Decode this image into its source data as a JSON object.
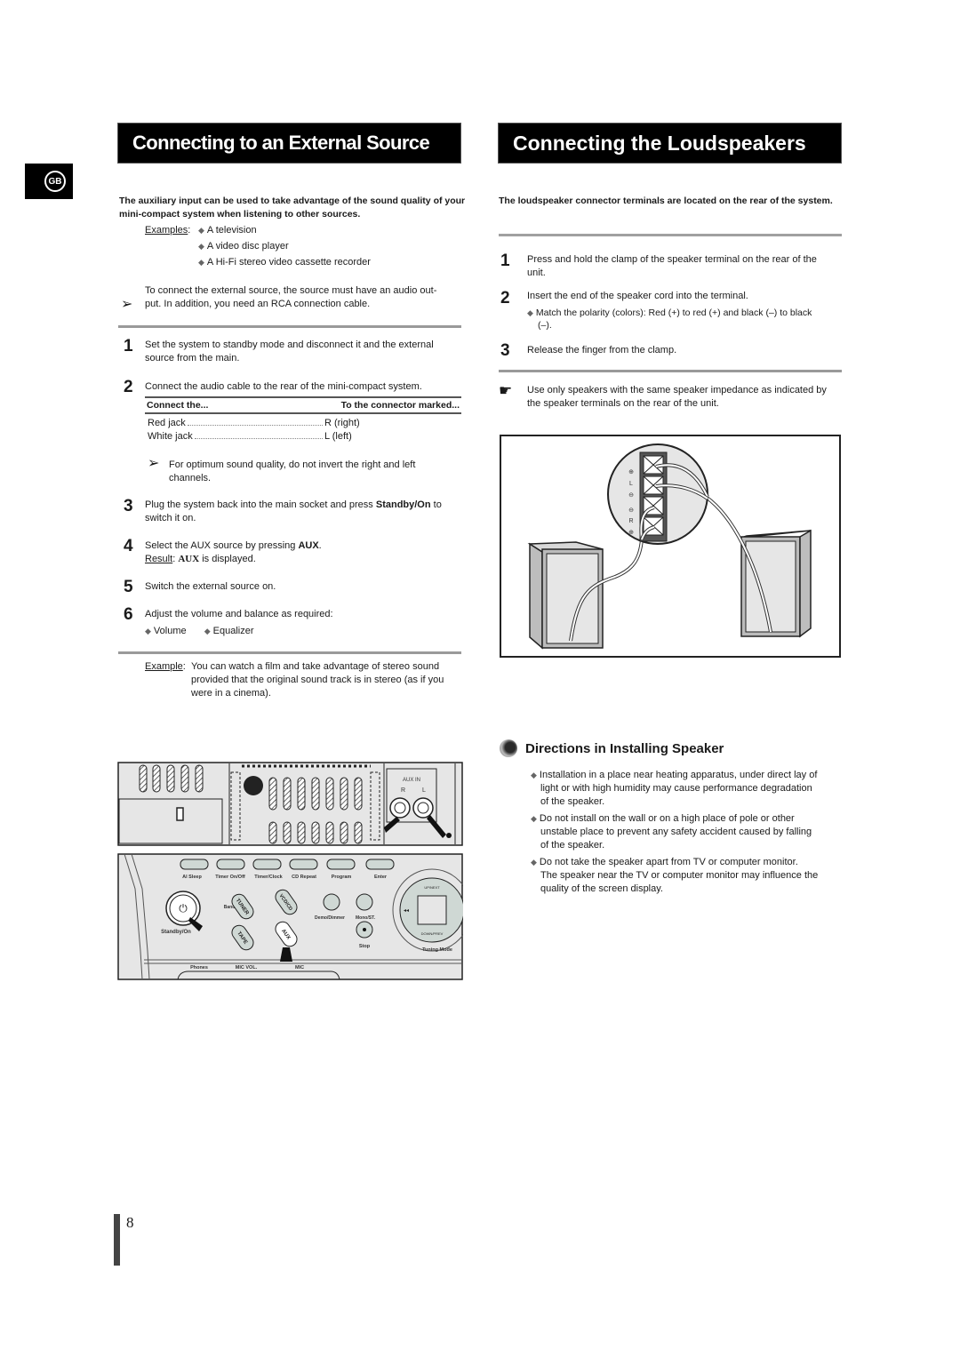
{
  "language_tab": "GB",
  "left": {
    "title": "Connecting to an External Source",
    "intro": "The auxiliary input can be used to take advantage of the sound quality of your mini-compact system when listening to other sources.",
    "examples_label": "Examples",
    "examples": [
      "A television",
      "A video disc player",
      "A Hi-Fi stereo video cassette recorder"
    ],
    "note1_line1": "To connect the external source, the source must have an audio out-",
    "note1_line2": "put. In addition, you need an RCA connection cable.",
    "steps": [
      {
        "num": "1",
        "text_line1": "Set the system to standby mode and disconnect it and the external",
        "text_line2": "source from the main."
      },
      {
        "num": "2",
        "text_line1": "Connect the audio cable to the rear of the mini-compact system."
      },
      {
        "num": "3",
        "text_pre": "Plug the system back into the main socket and press ",
        "text_bold": "Standby/On",
        "text_post": " to",
        "text_line2": "switch it on."
      },
      {
        "num": "4",
        "text_pre": "Select the AUX source by pressing ",
        "text_bold": "AUX",
        "text_post": ".",
        "result_label": "Result",
        "result_bold": "AUX",
        "result_text": " is displayed."
      },
      {
        "num": "5",
        "text_line1": "Switch the external source on."
      },
      {
        "num": "6",
        "text_line1": "Adjust the volume and balance as required:",
        "options": [
          "Volume",
          "Equalizer"
        ]
      }
    ],
    "table": {
      "headers": [
        "Connect the...",
        "To the connector marked..."
      ],
      "rows": [
        {
          "from": "Red jack",
          "to": "R (right)"
        },
        {
          "from": "White jack",
          "to": "L (left)"
        }
      ]
    },
    "note2_line1": "For optimum sound quality, do not invert the right and left",
    "note2_line2": "channels.",
    "example_label": "Example",
    "example_line1": "You can watch a film and take advantage of stereo sound",
    "example_line2": "provided that the original sound track is in stereo (as if you",
    "example_line3": "were in a cinema).",
    "rear_panel": {
      "aux_label": "AUX IN",
      "r_label": "R",
      "l_label": "L"
    },
    "front_panel": {
      "top_buttons": [
        "AI Sleep",
        "Timer On/Off",
        "Timer/Clock",
        "CD Repeat",
        "Program",
        "Enter"
      ],
      "standby_label": "Standby/On",
      "power_symbol": "⏻",
      "band_label": "Band",
      "tuner_label": "TUNER",
      "tape_label": "TAPE",
      "cd_label": "VCD/CD",
      "aux_label": "AUX",
      "demo_label": "Demo/Dimmer",
      "mono_label": "Mono/ST.",
      "stop_label": "Stop",
      "tuning_label": "Tuning Mode",
      "up_label": "UP/NEXT",
      "down_label": "DOWN/PREV",
      "phones_label": "Phones",
      "micvol_label": "MIC VOL.",
      "mic_label": "MIC"
    }
  },
  "right": {
    "title": "Connecting the Loudspeakers",
    "intro": "The loudspeaker connector terminals are located on the rear of the system.",
    "steps": [
      {
        "num": "1",
        "text_line1": "Press and hold the clamp of the speaker terminal on the rear of the",
        "text_line2": "unit."
      },
      {
        "num": "2",
        "text_line1": "Insert the end of the speaker cord into the terminal.",
        "sub_line1": "Match the polarity (colors): Red (+) to red (+) and black (–) to black",
        "sub_line2": "(–)."
      },
      {
        "num": "3",
        "text_line1": "Release the finger from the clamp."
      }
    ],
    "caution_line1": "Use only speakers with the same speaker impedance as indicated by",
    "caution_line2": "the speaker terminals on the rear of the unit.",
    "terminal_labels": {
      "plus": "⊕",
      "minus": "⊖",
      "l": "L",
      "r": "R"
    },
    "directions": {
      "heading": "Directions in Installing Speaker",
      "items": [
        [
          "Installation in a place near heating apparatus, under direct lay of",
          "light or with high humidity may cause performance degradation",
          "of the speaker."
        ],
        [
          "Do not install on the wall or on a high place of pole or other",
          "unstable place to prevent any safety accident caused by falling",
          "of the speaker."
        ],
        [
          "Do not take the speaker apart from TV or computer monitor.",
          "The speaker near the TV or computer monitor may influence the",
          "quality of the screen display."
        ]
      ]
    }
  },
  "page_number": "8"
}
